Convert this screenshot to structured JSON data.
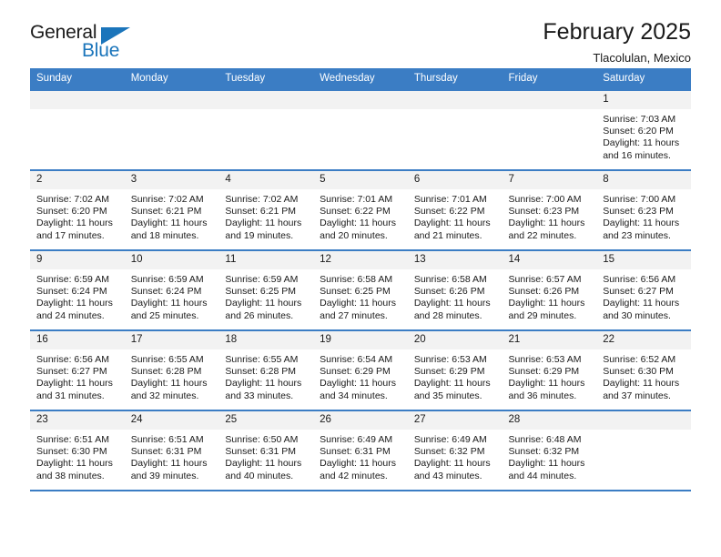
{
  "brand": {
    "word1": "General",
    "word2": "Blue",
    "triangle_color": "#1b75bb"
  },
  "header": {
    "title": "February 2025",
    "subtitle": "Tlacolulan, Mexico"
  },
  "theme": {
    "header_blue": "#3b7dc4",
    "daynum_bg": "#f2f2f2",
    "text": "#1a1a1a"
  },
  "weekdays": [
    "Sunday",
    "Monday",
    "Tuesday",
    "Wednesday",
    "Thursday",
    "Friday",
    "Saturday"
  ],
  "labels": {
    "sunrise": "Sunrise:",
    "sunset": "Sunset:",
    "daylight": "Daylight:"
  },
  "weeks": [
    [
      {
        "day": "",
        "sunrise": "",
        "sunset": "",
        "daylight": ""
      },
      {
        "day": "",
        "sunrise": "",
        "sunset": "",
        "daylight": ""
      },
      {
        "day": "",
        "sunrise": "",
        "sunset": "",
        "daylight": ""
      },
      {
        "day": "",
        "sunrise": "",
        "sunset": "",
        "daylight": ""
      },
      {
        "day": "",
        "sunrise": "",
        "sunset": "",
        "daylight": ""
      },
      {
        "day": "",
        "sunrise": "",
        "sunset": "",
        "daylight": ""
      },
      {
        "day": "1",
        "sunrise": "Sunrise: 7:03 AM",
        "sunset": "Sunset: 6:20 PM",
        "daylight": "Daylight: 11 hours and 16 minutes."
      }
    ],
    [
      {
        "day": "2",
        "sunrise": "Sunrise: 7:02 AM",
        "sunset": "Sunset: 6:20 PM",
        "daylight": "Daylight: 11 hours and 17 minutes."
      },
      {
        "day": "3",
        "sunrise": "Sunrise: 7:02 AM",
        "sunset": "Sunset: 6:21 PM",
        "daylight": "Daylight: 11 hours and 18 minutes."
      },
      {
        "day": "4",
        "sunrise": "Sunrise: 7:02 AM",
        "sunset": "Sunset: 6:21 PM",
        "daylight": "Daylight: 11 hours and 19 minutes."
      },
      {
        "day": "5",
        "sunrise": "Sunrise: 7:01 AM",
        "sunset": "Sunset: 6:22 PM",
        "daylight": "Daylight: 11 hours and 20 minutes."
      },
      {
        "day": "6",
        "sunrise": "Sunrise: 7:01 AM",
        "sunset": "Sunset: 6:22 PM",
        "daylight": "Daylight: 11 hours and 21 minutes."
      },
      {
        "day": "7",
        "sunrise": "Sunrise: 7:00 AM",
        "sunset": "Sunset: 6:23 PM",
        "daylight": "Daylight: 11 hours and 22 minutes."
      },
      {
        "day": "8",
        "sunrise": "Sunrise: 7:00 AM",
        "sunset": "Sunset: 6:23 PM",
        "daylight": "Daylight: 11 hours and 23 minutes."
      }
    ],
    [
      {
        "day": "9",
        "sunrise": "Sunrise: 6:59 AM",
        "sunset": "Sunset: 6:24 PM",
        "daylight": "Daylight: 11 hours and 24 minutes."
      },
      {
        "day": "10",
        "sunrise": "Sunrise: 6:59 AM",
        "sunset": "Sunset: 6:24 PM",
        "daylight": "Daylight: 11 hours and 25 minutes."
      },
      {
        "day": "11",
        "sunrise": "Sunrise: 6:59 AM",
        "sunset": "Sunset: 6:25 PM",
        "daylight": "Daylight: 11 hours and 26 minutes."
      },
      {
        "day": "12",
        "sunrise": "Sunrise: 6:58 AM",
        "sunset": "Sunset: 6:25 PM",
        "daylight": "Daylight: 11 hours and 27 minutes."
      },
      {
        "day": "13",
        "sunrise": "Sunrise: 6:58 AM",
        "sunset": "Sunset: 6:26 PM",
        "daylight": "Daylight: 11 hours and 28 minutes."
      },
      {
        "day": "14",
        "sunrise": "Sunrise: 6:57 AM",
        "sunset": "Sunset: 6:26 PM",
        "daylight": "Daylight: 11 hours and 29 minutes."
      },
      {
        "day": "15",
        "sunrise": "Sunrise: 6:56 AM",
        "sunset": "Sunset: 6:27 PM",
        "daylight": "Daylight: 11 hours and 30 minutes."
      }
    ],
    [
      {
        "day": "16",
        "sunrise": "Sunrise: 6:56 AM",
        "sunset": "Sunset: 6:27 PM",
        "daylight": "Daylight: 11 hours and 31 minutes."
      },
      {
        "day": "17",
        "sunrise": "Sunrise: 6:55 AM",
        "sunset": "Sunset: 6:28 PM",
        "daylight": "Daylight: 11 hours and 32 minutes."
      },
      {
        "day": "18",
        "sunrise": "Sunrise: 6:55 AM",
        "sunset": "Sunset: 6:28 PM",
        "daylight": "Daylight: 11 hours and 33 minutes."
      },
      {
        "day": "19",
        "sunrise": "Sunrise: 6:54 AM",
        "sunset": "Sunset: 6:29 PM",
        "daylight": "Daylight: 11 hours and 34 minutes."
      },
      {
        "day": "20",
        "sunrise": "Sunrise: 6:53 AM",
        "sunset": "Sunset: 6:29 PM",
        "daylight": "Daylight: 11 hours and 35 minutes."
      },
      {
        "day": "21",
        "sunrise": "Sunrise: 6:53 AM",
        "sunset": "Sunset: 6:29 PM",
        "daylight": "Daylight: 11 hours and 36 minutes."
      },
      {
        "day": "22",
        "sunrise": "Sunrise: 6:52 AM",
        "sunset": "Sunset: 6:30 PM",
        "daylight": "Daylight: 11 hours and 37 minutes."
      }
    ],
    [
      {
        "day": "23",
        "sunrise": "Sunrise: 6:51 AM",
        "sunset": "Sunset: 6:30 PM",
        "daylight": "Daylight: 11 hours and 38 minutes."
      },
      {
        "day": "24",
        "sunrise": "Sunrise: 6:51 AM",
        "sunset": "Sunset: 6:31 PM",
        "daylight": "Daylight: 11 hours and 39 minutes."
      },
      {
        "day": "25",
        "sunrise": "Sunrise: 6:50 AM",
        "sunset": "Sunset: 6:31 PM",
        "daylight": "Daylight: 11 hours and 40 minutes."
      },
      {
        "day": "26",
        "sunrise": "Sunrise: 6:49 AM",
        "sunset": "Sunset: 6:31 PM",
        "daylight": "Daylight: 11 hours and 42 minutes."
      },
      {
        "day": "27",
        "sunrise": "Sunrise: 6:49 AM",
        "sunset": "Sunset: 6:32 PM",
        "daylight": "Daylight: 11 hours and 43 minutes."
      },
      {
        "day": "28",
        "sunrise": "Sunrise: 6:48 AM",
        "sunset": "Sunset: 6:32 PM",
        "daylight": "Daylight: 11 hours and 44 minutes."
      },
      {
        "day": "",
        "sunrise": "",
        "sunset": "",
        "daylight": ""
      }
    ]
  ]
}
